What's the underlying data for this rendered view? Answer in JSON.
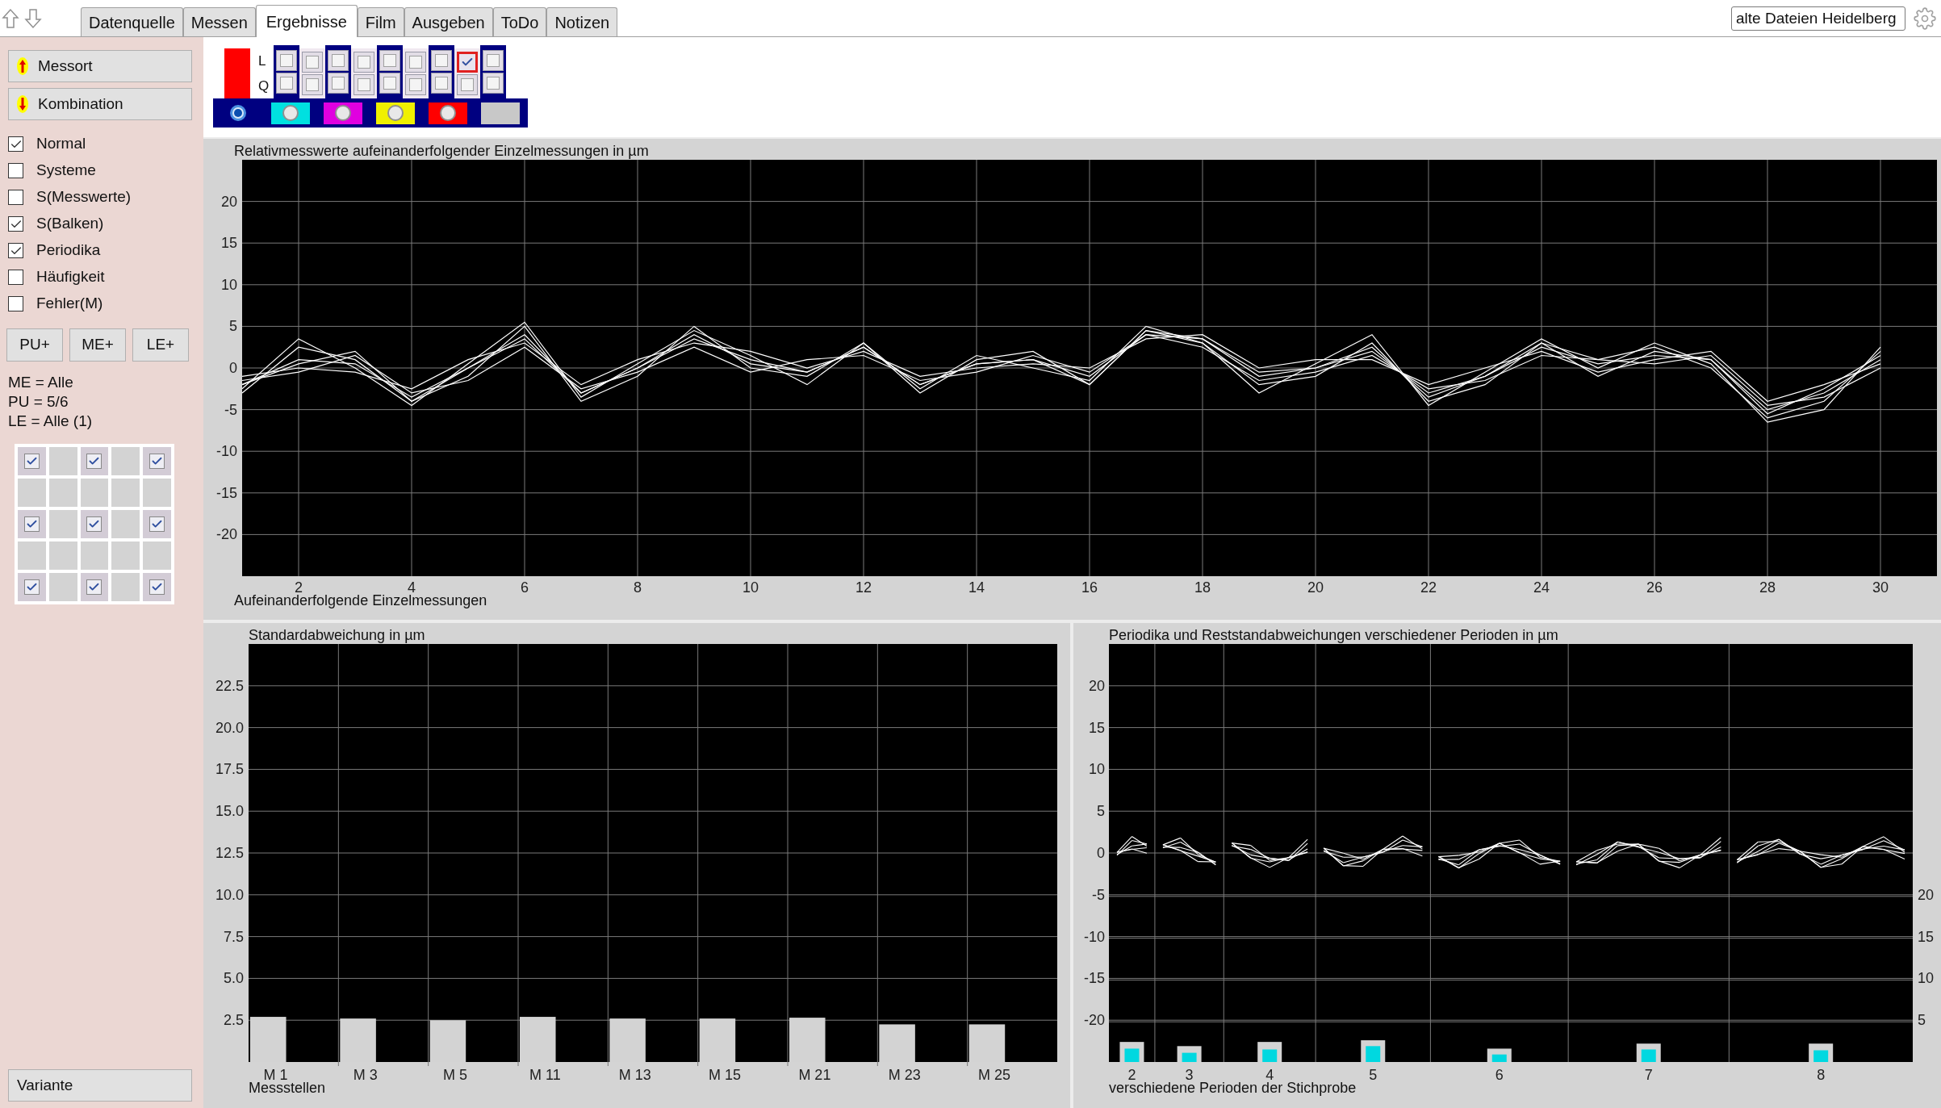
{
  "toolbar": {
    "tabs": [
      {
        "label": "Datenquelle",
        "selected": false
      },
      {
        "label": "Messen",
        "selected": false
      },
      {
        "label": "Ergebnisse",
        "selected": true
      },
      {
        "label": "Film",
        "selected": false
      },
      {
        "label": "Ausgeben",
        "selected": false
      },
      {
        "label": "ToDo",
        "selected": false
      },
      {
        "label": "Notizen",
        "selected": false
      }
    ],
    "source_field": {
      "value": "alte Dateien Heidelberg"
    }
  },
  "sidebar": {
    "nav_buttons": [
      {
        "label": "Messort",
        "kind": "up"
      },
      {
        "label": "Kombination",
        "kind": "down"
      }
    ],
    "options": [
      {
        "label": "Normal",
        "checked": true
      },
      {
        "label": "Systeme",
        "checked": false
      },
      {
        "label": "S(Messwerte)",
        "checked": false
      },
      {
        "label": "S(Balken)",
        "checked": true
      },
      {
        "label": "Periodika",
        "checked": true
      },
      {
        "label": "Häufigkeit",
        "checked": false
      },
      {
        "label": "Fehler(M)",
        "checked": false
      }
    ],
    "add_buttons": [
      "PU+",
      "ME+",
      "LE+"
    ],
    "info": [
      "ME = Alle",
      "PU = 5/6",
      "LE = Alle (1)"
    ],
    "grid": [
      [
        {
          "kind": "checkbox",
          "checked": true
        },
        {
          "kind": "empty"
        },
        {
          "kind": "checkbox",
          "checked": true
        },
        {
          "kind": "empty"
        },
        {
          "kind": "checkbox",
          "checked": true
        }
      ],
      [
        {
          "kind": "empty"
        },
        {
          "kind": "empty"
        },
        {
          "kind": "empty"
        },
        {
          "kind": "empty"
        },
        {
          "kind": "empty"
        }
      ],
      [
        {
          "kind": "checkbox",
          "checked": true
        },
        {
          "kind": "empty"
        },
        {
          "kind": "checkbox",
          "checked": true
        },
        {
          "kind": "empty"
        },
        {
          "kind": "checkbox",
          "checked": true
        }
      ],
      [
        {
          "kind": "empty"
        },
        {
          "kind": "empty"
        },
        {
          "kind": "empty"
        },
        {
          "kind": "empty"
        },
        {
          "kind": "empty"
        }
      ],
      [
        {
          "kind": "checkbox",
          "checked": true
        },
        {
          "kind": "empty"
        },
        {
          "kind": "checkbox",
          "checked": true
        },
        {
          "kind": "empty"
        },
        {
          "kind": "checkbox",
          "checked": true
        }
      ]
    ],
    "bottom_button": "Variante"
  },
  "selector": {
    "indicator": {
      "color": "#ff0000"
    },
    "rows": [
      {
        "label": "L",
        "boxes": [
          {
            "checked": false
          },
          {
            "checked": false
          },
          {
            "checked": false
          },
          {
            "checked": false
          },
          {
            "checked": false
          },
          {
            "checked": false
          },
          {
            "checked": false
          },
          {
            "checked": true
          },
          {
            "checked": false
          }
        ]
      },
      {
        "label": "Q",
        "boxes": [
          {
            "checked": false
          },
          {
            "checked": false
          },
          {
            "checked": false
          },
          {
            "checked": false
          },
          {
            "checked": false
          },
          {
            "checked": false
          },
          {
            "checked": false
          },
          {
            "checked": false
          },
          {
            "checked": false
          }
        ]
      }
    ],
    "swatches": [
      {
        "kind": "radio",
        "color": "#000080",
        "selected": true
      },
      {
        "kind": "radio",
        "color": "#00e0e0",
        "selected": false
      },
      {
        "kind": "radio",
        "color": "#e000e0",
        "selected": false
      },
      {
        "kind": "radio",
        "color": "#f0f000",
        "selected": false
      },
      {
        "kind": "radio",
        "color": "#ff0000",
        "selected": false
      },
      {
        "kind": "plain",
        "color": "#c8c8c8",
        "selected": false
      }
    ]
  },
  "top_chart": {
    "chart_data": {
      "type": "line",
      "title": "Relativmesswerte aufeinanderfolgender Einzelmessungen in µm",
      "xlabel": "Aufeinanderfolgende Einzelmessungen",
      "x": [
        1,
        2,
        3,
        4,
        5,
        6,
        7,
        8,
        9,
        10,
        11,
        12,
        13,
        14,
        15,
        16,
        17,
        18,
        19,
        20,
        21,
        22,
        23,
        24,
        25,
        26,
        27,
        28,
        29,
        30
      ],
      "series": [
        {
          "color": "#ffffff",
          "values": [
            -2,
            1,
            0.5,
            -3.5,
            0,
            4,
            -3,
            0,
            3.5,
            1,
            -0.5,
            2.5,
            -2,
            0.5,
            1,
            -1,
            4,
            3.5,
            -1,
            0,
            2,
            -3,
            -1,
            2.5,
            0.5,
            1.5,
            1,
            -5,
            -3,
            1
          ]
        },
        {
          "color": "#ffffff",
          "values": [
            -3,
            2.5,
            1,
            -4,
            -1,
            5,
            -4,
            -1,
            5,
            0,
            -1,
            3,
            -3,
            1,
            2,
            -2,
            4.5,
            3,
            -2,
            -1,
            3,
            -4,
            -2,
            3,
            1,
            2.5,
            0,
            -6,
            -4,
            2
          ]
        },
        {
          "color": "#ffffff",
          "values": [
            -1,
            0,
            -0.5,
            -2.5,
            1,
            3,
            -2,
            1,
            3,
            2,
            0,
            2,
            -1,
            0,
            0.5,
            0,
            3.5,
            4,
            0,
            1,
            1,
            -2,
            0,
            2,
            -0.5,
            1,
            2,
            -4,
            -2,
            0.5
          ]
        },
        {
          "color": "#ffffff",
          "values": [
            -2.5,
            3.5,
            0,
            -4.5,
            0.5,
            5.5,
            -3.5,
            0.5,
            4.5,
            1.5,
            -2,
            3,
            -2.5,
            1.5,
            0,
            -1.5,
            5,
            3,
            -3,
            0.5,
            4,
            -4.5,
            -0.5,
            3.5,
            0,
            3,
            0.5,
            -6.5,
            -5,
            2.5
          ]
        },
        {
          "color": "#ffffff",
          "values": [
            -1.5,
            -0.5,
            1.5,
            -3,
            -1.5,
            2.5,
            -2.5,
            -0.5,
            2.5,
            -0.5,
            1,
            1.5,
            -1.5,
            -0.5,
            1.5,
            -0.5,
            4,
            2.5,
            -1.5,
            -0.5,
            1.5,
            -2.5,
            -1.5,
            1.5,
            1,
            0.5,
            1.5,
            -4.5,
            -3.5,
            0
          ]
        },
        {
          "color": "#ffffff",
          "values": [
            -2,
            0.5,
            2,
            -4,
            0,
            3.5,
            -3,
            0,
            4,
            0.5,
            -0.5,
            2.5,
            -2,
            0.5,
            1,
            -2,
            4.5,
            3.5,
            -0.5,
            0,
            2.5,
            -3.5,
            -1,
            3,
            -1,
            2,
            1,
            -5.5,
            -2.5,
            1.5
          ]
        }
      ],
      "grid": true,
      "xlim": [
        1,
        31
      ],
      "ylim": [
        -25,
        25
      ],
      "xticks": [
        2,
        4,
        6,
        8,
        10,
        12,
        14,
        16,
        18,
        20,
        22,
        24,
        26,
        28,
        30
      ],
      "yticks": [
        -20,
        -15,
        -10,
        -5,
        0,
        5,
        10,
        15,
        20
      ]
    }
  },
  "std_chart": {
    "chart_data": {
      "type": "bar",
      "title": "Standardabweichung in µm",
      "xlabel": "Messstellen",
      "categories": [
        "M 1",
        "M 3",
        "M 5",
        "M 11",
        "M 13",
        "M 15",
        "M 21",
        "M 23",
        "M 25"
      ],
      "values": [
        2.7,
        2.6,
        2.5,
        2.7,
        2.6,
        2.6,
        2.65,
        2.25,
        2.25
      ],
      "grid": true,
      "ylim": [
        0,
        25
      ],
      "yticks": [
        {
          "value": 2.5,
          "label": "2.5"
        },
        {
          "value": 5,
          "label": "5.0"
        },
        {
          "value": 7.5,
          "label": "7.5"
        },
        {
          "value": 10,
          "label": "10.0"
        },
        {
          "value": 12.5,
          "label": "12.5"
        },
        {
          "value": 15,
          "label": "15.0"
        },
        {
          "value": 17.5,
          "label": "17.5"
        },
        {
          "value": 20,
          "label": "20.0"
        },
        {
          "value": 22.5,
          "label": "22.5"
        }
      ]
    }
  },
  "period_chart": {
    "left_axis_ticks": [
      "20",
      "15",
      "10",
      "5",
      "0",
      "-5",
      "-10",
      "-15",
      "-20"
    ],
    "chart_data": {
      "type": "bar",
      "title": "Periodika und Reststandabweichungen verschiedener Perioden in µm",
      "xlabel": "verschiedene Perioden der Stichprobe",
      "categories": [
        "2",
        "3",
        "4",
        "5",
        "6",
        "7",
        "8"
      ],
      "series": [
        {
          "color": "#d3d3d3",
          "values": [
            2.4,
            1.9,
            2.4,
            2.6,
            1.6,
            2.2,
            2.2
          ]
        },
        {
          "color": "#00d8e0",
          "values": [
            1.6,
            1.1,
            1.5,
            1.9,
            0.9,
            1.5,
            1.4
          ]
        }
      ],
      "grid": true,
      "ylim": [
        0,
        50
      ],
      "yticks": [
        5,
        10,
        15,
        20
      ]
    }
  }
}
